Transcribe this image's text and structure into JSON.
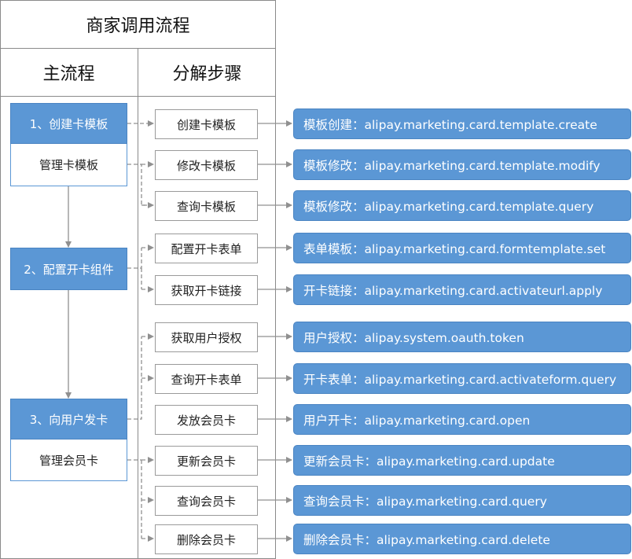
{
  "header": {
    "title": "商家调用流程",
    "col_main": "主流程",
    "col_steps": "分解步骤"
  },
  "main": [
    {
      "label": "1、创建卡模板",
      "sub": "管理卡模板"
    },
    {
      "label": "2、配置开卡组件"
    },
    {
      "label": "3、向用户发卡",
      "sub": "管理会员卡"
    }
  ],
  "steps": [
    {
      "label": "创建卡模板",
      "api": "模板创建：alipay.marketing.card.template.create"
    },
    {
      "label": "修改卡模板",
      "api": "模板修改：alipay.marketing.card.template.modify"
    },
    {
      "label": "查询卡模板",
      "api": "模板修改：alipay.marketing.card.template.query"
    },
    {
      "label": "配置开卡表单",
      "api": "表单模板：alipay.marketing.card.formtemplate.set"
    },
    {
      "label": "获取开卡链接",
      "api": "开卡链接：alipay.marketing.card.activateurl.apply"
    },
    {
      "label": "获取用户授权",
      "api": "用户授权：alipay.system.oauth.token"
    },
    {
      "label": "查询开卡表单",
      "api": "开卡表单：alipay.marketing.card.activateform.query"
    },
    {
      "label": "发放会员卡",
      "api": "用户开卡：alipay.marketing.card.open"
    },
    {
      "label": "更新会员卡",
      "api": "更新会员卡：alipay.marketing.card.update"
    },
    {
      "label": "查询会员卡",
      "api": "查询会员卡：alipay.marketing.card.query"
    },
    {
      "label": "删除会员卡",
      "api": "删除会员卡：alipay.marketing.card.delete"
    }
  ],
  "colors": {
    "box_blue": "#5b97d5",
    "border_gray": "#9a9a9a",
    "arrow_gray": "#909090"
  }
}
